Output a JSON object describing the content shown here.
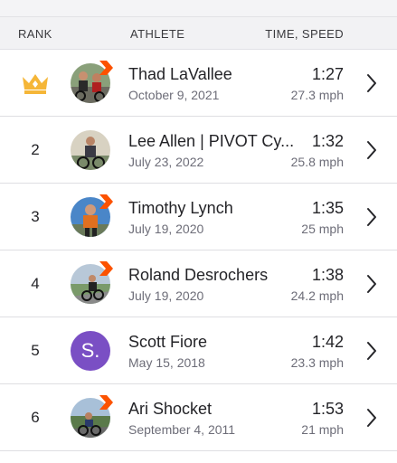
{
  "header": {
    "rank_label": "RANK",
    "athlete_label": "ATHLETE",
    "time_label": "TIME, SPEED"
  },
  "colors": {
    "crown": "#f5b638",
    "subscriber_badge": "#fc5200",
    "initial_avatar_bg": "#7a4fc4"
  },
  "rows": [
    {
      "rank": "",
      "rank_icon": "crown-icon",
      "name": "Thad LaVallee",
      "date": "October 9, 2021",
      "time": "1:27",
      "speed": "27.3 mph",
      "avatar": "photo",
      "subscriber": true
    },
    {
      "rank": "2",
      "name": "Lee Allen | PIVOT Cy...",
      "date": "July 23, 2022",
      "time": "1:32",
      "speed": "25.8 mph",
      "avatar": "photo",
      "subscriber": false
    },
    {
      "rank": "3",
      "name": "Timothy Lynch",
      "date": "July 19, 2020",
      "time": "1:35",
      "speed": "25 mph",
      "avatar": "photo",
      "subscriber": true
    },
    {
      "rank": "4",
      "name": "Roland Desrochers",
      "date": "July 19, 2020",
      "time": "1:38",
      "speed": "24.2 mph",
      "avatar": "photo",
      "subscriber": true
    },
    {
      "rank": "5",
      "name": "Scott Fiore",
      "date": "May 15, 2018",
      "time": "1:42",
      "speed": "23.3 mph",
      "avatar": "initial",
      "avatar_initial": "S.",
      "subscriber": false
    },
    {
      "rank": "6",
      "name": "Ari Shocket",
      "date": "September 4, 2011",
      "time": "1:53",
      "speed": "21 mph",
      "avatar": "photo",
      "subscriber": true
    }
  ]
}
